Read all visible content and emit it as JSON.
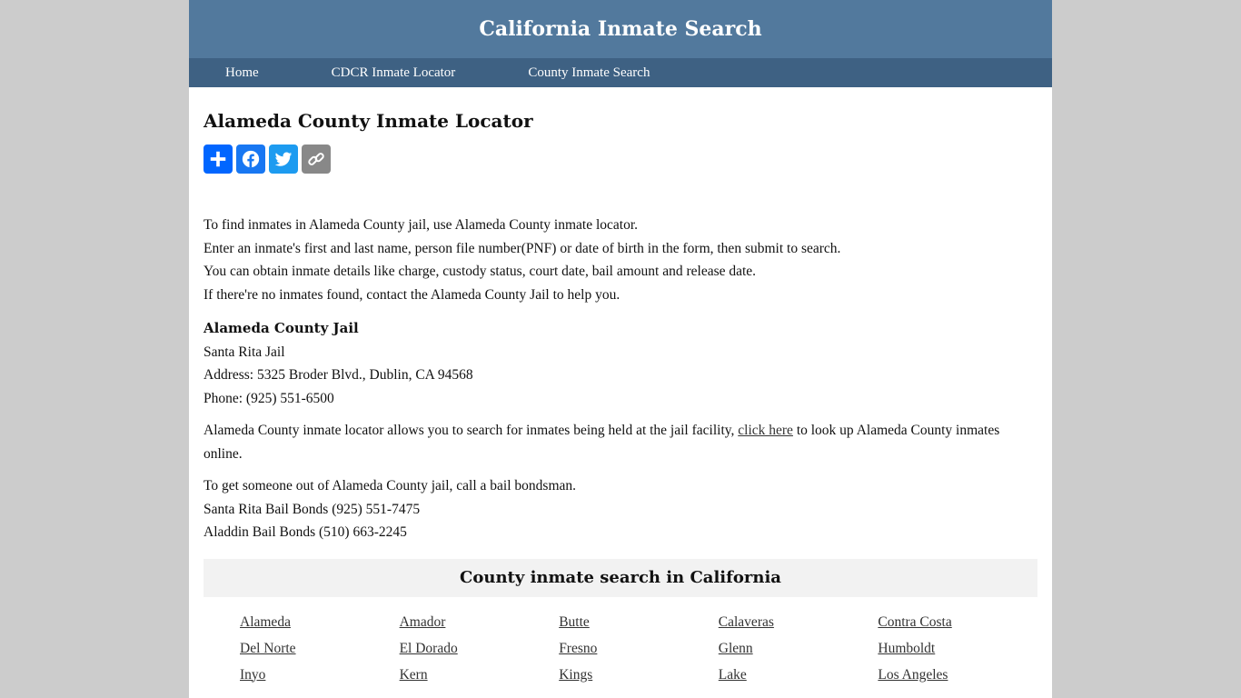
{
  "header": {
    "site_title": "California Inmate Search"
  },
  "nav": {
    "items": [
      {
        "label": "Home"
      },
      {
        "label": "CDCR Inmate Locator"
      },
      {
        "label": "County Inmate Search"
      }
    ]
  },
  "main": {
    "title": "Alameda County Inmate Locator",
    "share_buttons": [
      {
        "icon": "plus-icon",
        "label": "Share"
      },
      {
        "icon": "facebook-icon",
        "label": "Facebook"
      },
      {
        "icon": "twitter-icon",
        "label": "Twitter"
      },
      {
        "icon": "link-icon",
        "label": "Copy Link"
      }
    ],
    "intro_lines": [
      "To find inmates in Alameda County jail, use Alameda County inmate locator.",
      "Enter an inmate's first and last name, person file number(PNF) or date of birth in the form, then submit to search.",
      "You can obtain inmate details like charge, custody status, court date, bail amount and release date.",
      "If there're no inmates found, contact the Alameda County Jail to help you."
    ],
    "jail": {
      "name": "Alameda County Jail",
      "facility": "Santa Rita Jail",
      "address": "Address: 5325 Broder Blvd., Dublin, CA 94568",
      "phone": "Phone: (925) 551-6500"
    },
    "locator_text_before": "Alameda County inmate locator allows you to search for inmates being held at the jail facility, ",
    "locator_link": "click here",
    "locator_text_after": " to look up Alameda County inmates online.",
    "bail_lines": [
      "To get someone out of Alameda County jail, call a bail bondsman.",
      "Santa Rita Bail Bonds (925) 551-7475",
      "Aladdin Bail Bonds (510) 663-2245"
    ]
  },
  "counties": {
    "heading": "County inmate search in California",
    "items": [
      "Alameda",
      "Amador",
      "Butte",
      "Calaveras",
      "Contra Costa",
      "Del Norte",
      "El Dorado",
      "Fresno",
      "Glenn",
      "Humboldt",
      "Inyo",
      "Kern",
      "Kings",
      "Lake",
      "Los Angeles"
    ]
  },
  "colors": {
    "header_bg": "#52799d",
    "nav_bg": "#3e6183",
    "page_bg": "#cccccc",
    "county_box_bg": "#f2f2f2"
  }
}
